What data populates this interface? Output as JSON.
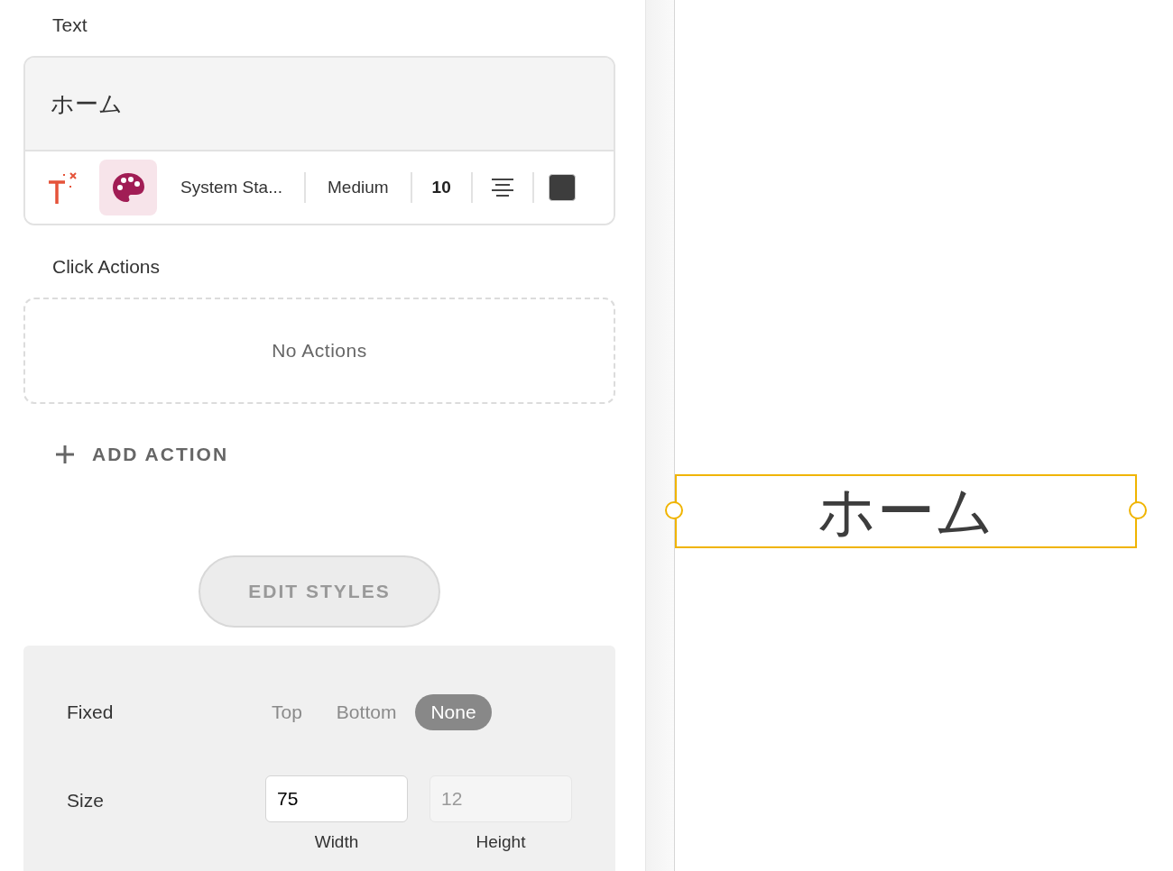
{
  "text_section": {
    "label": "Text",
    "value": "ホーム",
    "toolbar": {
      "font": "System Sta...",
      "weight": "Medium",
      "size": "10",
      "color": "#3d3d3d"
    }
  },
  "click_actions": {
    "label": "Click Actions",
    "empty_text": "No Actions",
    "add_button": "ADD ACTION"
  },
  "edit_styles_button": "EDIT STYLES",
  "layout": {
    "fixed": {
      "label": "Fixed",
      "options": [
        {
          "label": "Top",
          "selected": false
        },
        {
          "label": "Bottom",
          "selected": false
        },
        {
          "label": "None",
          "selected": true
        }
      ]
    },
    "size": {
      "label": "Size",
      "width": {
        "value": "75",
        "caption": "Width",
        "disabled": false
      },
      "height": {
        "value": "12",
        "caption": "Height",
        "disabled": true
      }
    }
  },
  "canvas": {
    "element_text": "ホーム",
    "selected": true
  }
}
